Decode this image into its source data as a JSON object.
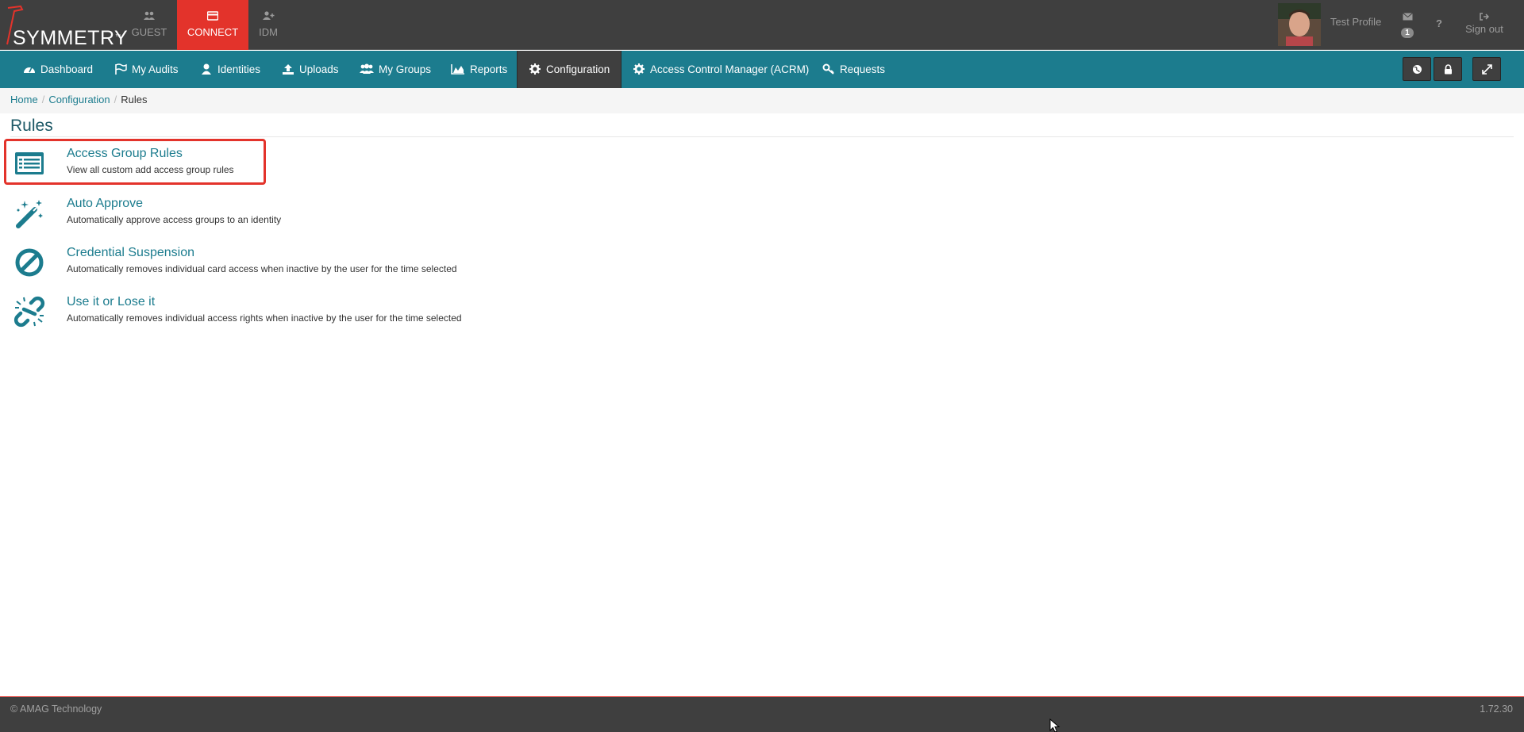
{
  "brand": {
    "logo_text": "SYMMETRY",
    "tm": "™"
  },
  "app_tabs": [
    {
      "label": "GUEST",
      "icon": "users-icon"
    },
    {
      "label": "CONNECT",
      "icon": "card-icon",
      "active": true
    },
    {
      "label": "IDM",
      "icon": "user-plus-icon"
    }
  ],
  "user": {
    "name": "Test Profile",
    "messages_count": "1",
    "help": "?",
    "sign_out": "Sign out"
  },
  "nav": [
    {
      "label": "Dashboard",
      "icon": "dashboard-icon"
    },
    {
      "label": "My Audits",
      "icon": "flag-icon"
    },
    {
      "label": "Identities",
      "icon": "user-icon"
    },
    {
      "label": "Uploads",
      "icon": "upload-icon"
    },
    {
      "label": "My Groups",
      "icon": "group-icon"
    },
    {
      "label": "Reports",
      "icon": "area-chart-icon"
    },
    {
      "label": "Configuration",
      "icon": "gear-icon",
      "active": true
    },
    {
      "label": "Access Control Manager (ACRM)",
      "icon": "gear-icon"
    },
    {
      "label": "Requests",
      "icon": "key-icon"
    }
  ],
  "nav_buttons": [
    "globe-icon",
    "lock-icon",
    "expand-icon"
  ],
  "breadcrumb": {
    "home": "Home",
    "configuration": "Configuration",
    "current": "Rules",
    "sep": "/"
  },
  "page": {
    "title": "Rules"
  },
  "rules": [
    {
      "title": "Access Group Rules",
      "desc": "View all custom add access group rules",
      "icon": "list-alt-icon",
      "highlighted": true
    },
    {
      "title": "Auto Approve",
      "desc": "Automatically approve access groups to an identity",
      "icon": "magic-wand-icon"
    },
    {
      "title": "Credential Suspension",
      "desc": "Automatically removes individual card access when inactive by the user for the time selected",
      "icon": "ban-icon"
    },
    {
      "title": "Use it or Lose it",
      "desc": "Automatically removes individual access rights when inactive by the user for the time selected",
      "icon": "broken-link-icon"
    }
  ],
  "footer": {
    "copyright": "© AMAG Technology",
    "version": "1.72.30"
  },
  "colors": {
    "teal": "#1c7c8e",
    "red": "#e3332b",
    "dark": "#3f3f3f"
  }
}
